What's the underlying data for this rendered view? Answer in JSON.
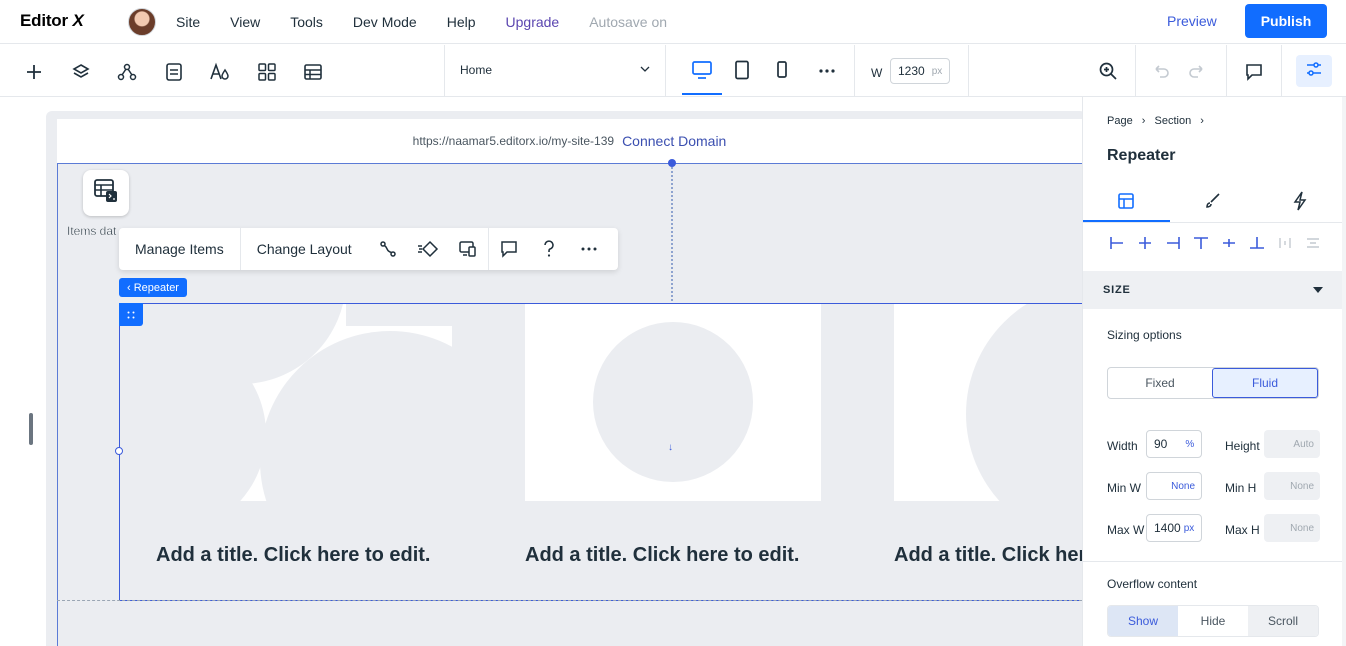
{
  "app": {
    "logo": "Editor",
    "logo_x": "X"
  },
  "menu": [
    "Site",
    "View",
    "Tools",
    "Dev Mode",
    "Help"
  ],
  "upgrade": "Upgrade",
  "autosave": "Autosave on",
  "preview": "Preview",
  "publish": "Publish",
  "page_select": {
    "value": "Home"
  },
  "width": {
    "label": "W",
    "value": "1230",
    "unit": "px"
  },
  "url": {
    "address": "https://naamar5.editorx.io/my-site-139",
    "connect": "Connect Domain"
  },
  "dataset_label": "Items dat",
  "context_toolbar": {
    "manage": "Manage Items",
    "layout": "Change Layout"
  },
  "repeater_tag": "‹ Repeater",
  "items": [
    {
      "title": "Add a title. Click here to edit."
    },
    {
      "title": "Add a title. Click here to edit."
    },
    {
      "title": "Add a title. Click here to edit."
    }
  ],
  "panel": {
    "breadcrumb": [
      "Page",
      "Section"
    ],
    "title": "Repeater",
    "size_header": "SIZE",
    "sizing_options": "Sizing options",
    "fixed": "Fixed",
    "fluid": "Fluid",
    "width_label": "Width",
    "width_value": "90",
    "width_unit": "%",
    "height_label": "Height",
    "height_value": "Auto",
    "minw_label": "Min W",
    "minw_value": "None",
    "minh_label": "Min H",
    "minh_value": "None",
    "maxw_label": "Max W",
    "maxw_value": "1400",
    "maxw_unit": "px",
    "maxh_label": "Max H",
    "maxh_value": "None",
    "overflow_label": "Overflow content",
    "overflow_options": [
      "Show",
      "Hide",
      "Scroll"
    ]
  },
  "colors": {
    "accent": "#116dff",
    "upgrade": "#5b46b0"
  }
}
